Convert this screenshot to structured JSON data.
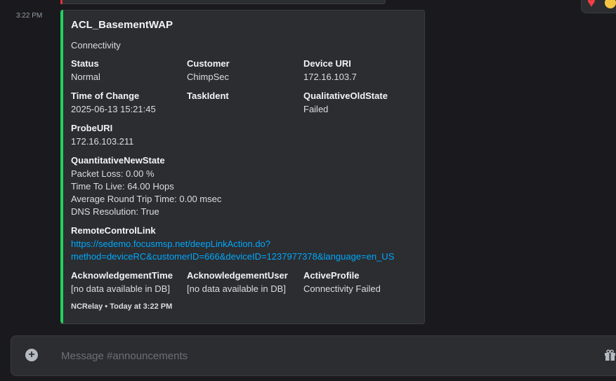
{
  "message": {
    "timestamp": "3:22 PM"
  },
  "embed": {
    "accent_color": "#23d160",
    "title": "ACL_BasementWAP",
    "description": "Connectivity",
    "fields": {
      "status": {
        "name": "Status",
        "value": "Normal"
      },
      "customer": {
        "name": "Customer",
        "value": "ChimpSec"
      },
      "device_uri": {
        "name": "Device URI",
        "value": "172.16.103.7"
      },
      "time_of_change": {
        "name": "Time of Change",
        "value": "2025-06-13 15:21:45"
      },
      "task_ident": {
        "name": "TaskIdent",
        "value": ""
      },
      "qualitative_old_state": {
        "name": "QualitativeOldState",
        "value": "Failed"
      },
      "probe_uri": {
        "name": "ProbeURI",
        "value": "172.16.103.211"
      },
      "quantitative_new_state": {
        "name": "QuantitativeNewState",
        "lines": [
          "Packet Loss: 0.00 %",
          "Time To Live: 64.00 Hops",
          "Average Round Trip Time: 0.00 msec",
          "DNS Resolution: True"
        ]
      },
      "remote_control_link": {
        "name": "RemoteControlLink",
        "lines": [
          "https://sedemo.focusmsp.net/deepLinkAction.do?",
          "method=deviceRC&customerID=666&deviceID=1237977378&language=en_US"
        ]
      },
      "acknowledgement_time": {
        "name": "AcknowledgementTime",
        "value": "[no data available in DB]"
      },
      "acknowledgement_user": {
        "name": "AcknowledgementUser",
        "value": "[no data available in DB]"
      },
      "active_profile": {
        "name": "ActiveProfile",
        "value": "Connectivity Failed"
      }
    },
    "footer": "NCRelay • Today at 3:22 PM"
  },
  "composer": {
    "placeholder": "Message #announcements",
    "icons": [
      "plus-circle-icon",
      "gift-icon"
    ]
  },
  "reactions": [
    "heart",
    "laughing-face"
  ]
}
